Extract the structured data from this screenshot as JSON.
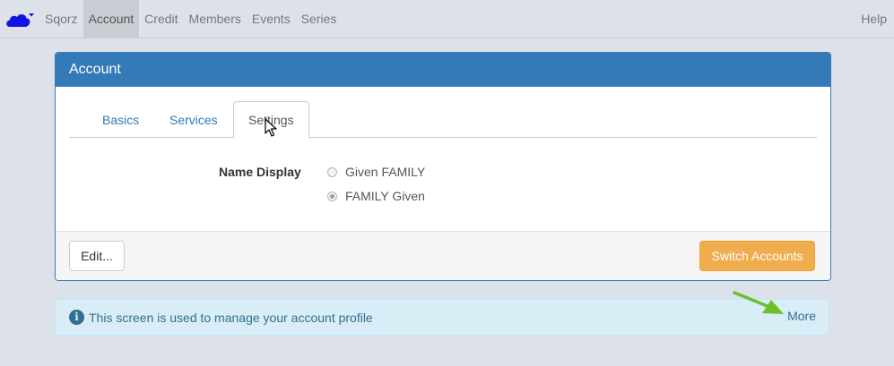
{
  "navbar": {
    "logo_icon": "cloud-icon",
    "items": [
      {
        "label": "Sqorz"
      },
      {
        "label": "Account",
        "active": true
      },
      {
        "label": "Credit"
      },
      {
        "label": "Members"
      },
      {
        "label": "Events"
      },
      {
        "label": "Series"
      }
    ],
    "help_label": "Help"
  },
  "panel": {
    "title": "Account",
    "tabs": [
      {
        "label": "Basics"
      },
      {
        "label": "Services"
      },
      {
        "label": "Settings",
        "active": true
      }
    ],
    "name_display": {
      "label": "Name Display",
      "options": [
        {
          "label": "Given FAMILY",
          "checked": false
        },
        {
          "label": "FAMILY Given",
          "checked": true
        }
      ]
    },
    "footer": {
      "edit_label": "Edit...",
      "switch_label": "Switch Accounts"
    }
  },
  "alert": {
    "icon": "info-icon",
    "text": "This screen is used to manage your account profile",
    "more_label": "More"
  },
  "colors": {
    "navbar_bg": "#dde1ea",
    "panel_heading": "#337ab7",
    "warning_button": "#f0ad4e",
    "info_bg": "#d9edf7",
    "info_text": "#31708f",
    "arrow": "#6cc12b",
    "logo": "#1414e0"
  }
}
